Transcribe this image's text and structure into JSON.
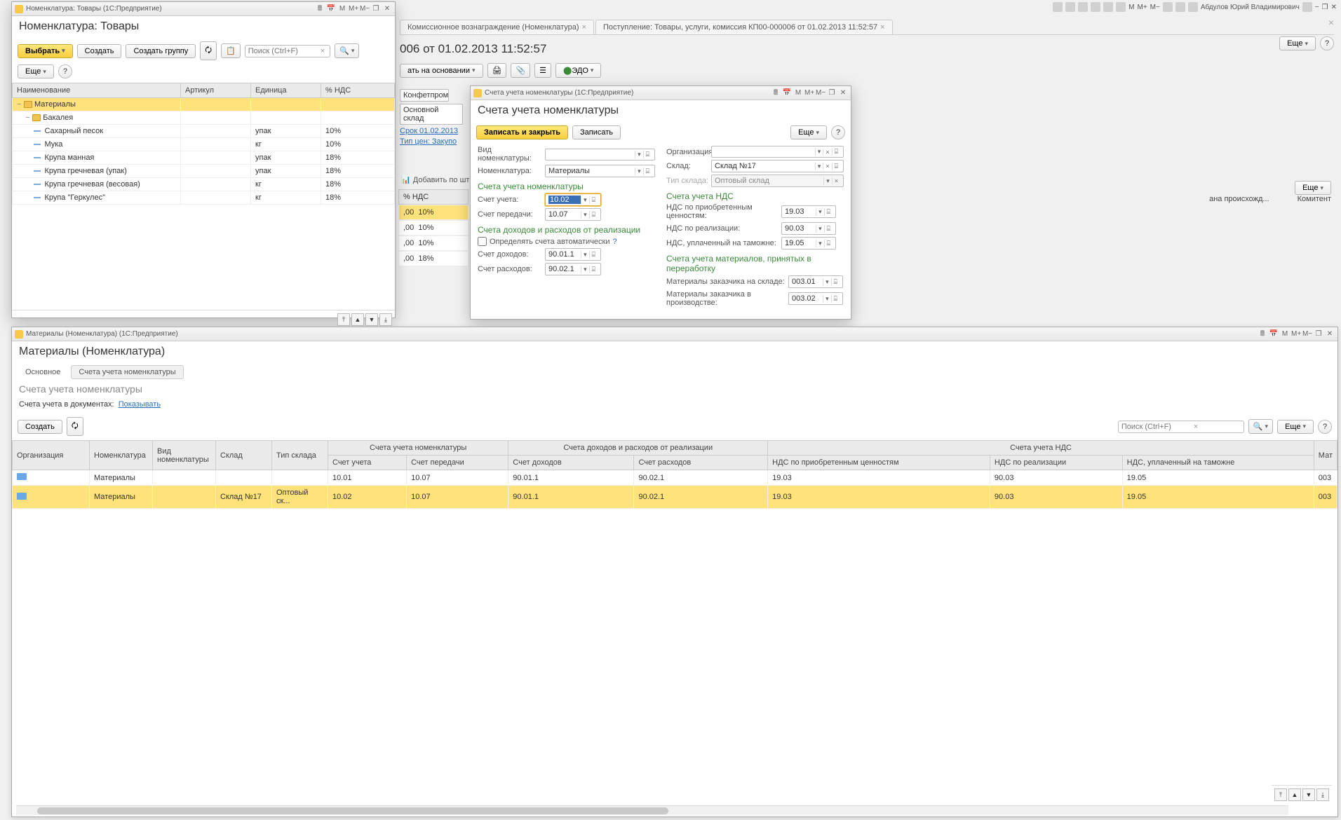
{
  "app_bar": {
    "m": "M",
    "mp": "M+",
    "mm": "M−",
    "user": "Абдулов Юрий Владимирович"
  },
  "bg": {
    "tabs": [
      {
        "label": "Комиссионное вознаграждение (Номенклатура)"
      },
      {
        "label": "Поступление: Товары, услуги, комиссия КП00-000006 от 01.02.2013 11:52:57"
      }
    ],
    "doc_title_tail": "006 от 01.02.2013 11:52:57",
    "btn_base": "ать на основании",
    "edo": "ЭДО",
    "more": "Еще",
    "org_val": "Конфетпром",
    "wh_val": "Основной склад",
    "term_link": "Срок 01.02.2013",
    "price_link": "Тип цен: Закупо",
    "add_barcode": "Добавить по штрихк",
    "col_nds": "% НДС",
    "rows": [
      {
        "sum": ",00",
        "nds": "10%",
        "sel": true
      },
      {
        "sum": ",00",
        "nds": "10%"
      },
      {
        "sum": ",00",
        "nds": "10%"
      },
      {
        "sum": ",00",
        "nds": "18%"
      }
    ],
    "cols_right": [
      "ана происхожд...",
      "Комитент"
    ]
  },
  "nom_win": {
    "title": "Номенклатура: Товары  (1С:Предприятие)",
    "heading": "Номенклатура: Товары",
    "btn_select": "Выбрать",
    "btn_create": "Создать",
    "btn_create_group": "Создать группу",
    "search_ph": "Поиск (Ctrl+F)",
    "more": "Еще",
    "cols": {
      "name": "Наименование",
      "art": "Артикул",
      "unit": "Единица",
      "nds": "% НДС"
    },
    "rows": [
      {
        "level": 0,
        "type": "folder",
        "exp": "−",
        "name": "Материалы",
        "unit": "",
        "nds": "",
        "sel": true
      },
      {
        "level": 1,
        "type": "folder",
        "exp": "−",
        "name": "Бакалея",
        "unit": "",
        "nds": ""
      },
      {
        "level": 2,
        "type": "item",
        "name": "Сахарный песок",
        "unit": "упак",
        "nds": "10%"
      },
      {
        "level": 2,
        "type": "item",
        "name": "Мука",
        "unit": "кг",
        "nds": "10%"
      },
      {
        "level": 2,
        "type": "item",
        "name": "Крупа манная",
        "unit": "упак",
        "nds": "18%"
      },
      {
        "level": 2,
        "type": "item",
        "name": "Крупа гречневая (упак)",
        "unit": "упак",
        "nds": "18%"
      },
      {
        "level": 2,
        "type": "item",
        "name": "Крупа гречневая (весовая)",
        "unit": "кг",
        "nds": "18%"
      },
      {
        "level": 2,
        "type": "item",
        "name": "Крупа \"Геркулес\"",
        "unit": "кг",
        "nds": "18%"
      }
    ]
  },
  "acct_win": {
    "title": "Счета учета номенклатуры  (1С:Предприятие)",
    "heading": "Счета учета номенклатуры",
    "btn_save_close": "Записать и закрыть",
    "btn_save": "Записать",
    "more": "Еще",
    "lbl_kind": "Вид номенклатуры:",
    "lbl_nom": "Номенклатура:",
    "val_nom": "Материалы",
    "lbl_org": "Организация:",
    "lbl_wh": "Склад:",
    "val_wh": "Склад №17",
    "lbl_wh_type": "Тип склада:",
    "val_wh_type": "Оптовый склад",
    "g1": "Счета учета номенклатуры",
    "lbl_acct": "Счет учета:",
    "val_acct": "10.02",
    "lbl_transfer": "Счет передачи:",
    "val_transfer": "10.07",
    "g2": "Счета учета НДС",
    "lbl_nds_in": "НДС по приобретенным ценностям:",
    "val_nds_in": "19.03",
    "lbl_nds_out": "НДС по реализации:",
    "val_nds_out": "90.03",
    "lbl_nds_cust": "НДС, уплаченный на таможне:",
    "val_nds_cust": "19.05",
    "g3": "Счета доходов и расходов от реализации",
    "chk_auto": "Определять счета автоматически",
    "lbl_income": "Счет доходов:",
    "val_income": "90.01.1",
    "lbl_expense": "Счет расходов:",
    "val_expense": "90.02.1",
    "g4": "Счета учета материалов, принятых в переработку",
    "lbl_mat_wh": "Материалы заказчика на складе:",
    "val_mat_wh": "003.01",
    "lbl_mat_prod": "Материалы заказчика в производстве:",
    "val_mat_prod": "003.02"
  },
  "mat_win": {
    "title": "Материалы (Номенклатура)   (1С:Предприятие)",
    "heading": "Материалы (Номенклатура)",
    "tab_main": "Основное",
    "tab_accts": "Счета учета номенклатуры",
    "subtitle": "Счета учета номенклатуры",
    "docs_lbl": "Счета учета в документах:",
    "docs_link": "Показывать",
    "btn_create": "Создать",
    "search_ph": "Поиск (Ctrl+F)",
    "more": "Еще",
    "groups": {
      "accts": "Счета учета номенклатуры",
      "sales": "Счета доходов и расходов от реализации",
      "nds": "Счета учета НДС"
    },
    "cols": {
      "org": "Организация",
      "nom": "Номенклатура",
      "kind": "Вид номенклатуры",
      "wh": "Склад",
      "wh_type": "Тип склада",
      "acct": "Счет учета",
      "transfer": "Счет передачи",
      "income": "Счет доходов",
      "expense": "Счет расходов",
      "nds_in": "НДС по приобретенным ценностям",
      "nds_out": "НДС по реализации",
      "nds_cust": "НДС, уплаченный на таможне",
      "mat": "Мат"
    },
    "rows": [
      {
        "nom": "Материалы",
        "wh": "",
        "wh_type": "",
        "acct": "10.01",
        "transfer": "10.07",
        "income": "90.01.1",
        "expense": "90.02.1",
        "nds_in": "19.03",
        "nds_out": "90.03",
        "nds_cust": "19.05",
        "mat": "003"
      },
      {
        "nom": "Материалы",
        "wh": "Склад №17",
        "wh_type": "Оптовый ск...",
        "acct": "10.02",
        "transfer": "10.07",
        "income": "90.01.1",
        "expense": "90.02.1",
        "nds_in": "19.03",
        "nds_out": "90.03",
        "nds_cust": "19.05",
        "mat": "003",
        "sel": true
      }
    ]
  }
}
